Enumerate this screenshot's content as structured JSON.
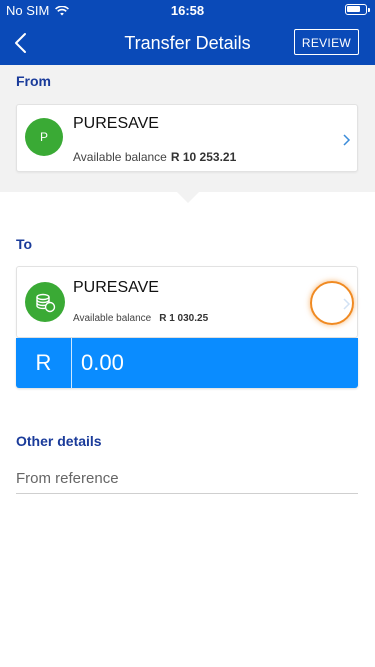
{
  "status_bar": {
    "carrier": "No SIM",
    "time": "16:58"
  },
  "header": {
    "title": "Transfer Details",
    "review_label": "REVIEW"
  },
  "from": {
    "label": "From",
    "account": {
      "avatar_letter": "P",
      "name": "PURESAVE",
      "balance_label": "Available balance",
      "balance_value": "R 10 253.21"
    }
  },
  "to": {
    "label": "To",
    "account": {
      "name": "PURESAVE",
      "balance_label": "Available balance",
      "balance_value": "R 1 030.25"
    }
  },
  "amount": {
    "currency": "R",
    "value": "0.00"
  },
  "other_details": {
    "label": "Other details",
    "reference_placeholder": "From reference"
  },
  "colors": {
    "header_blue": "#0a4ab8",
    "amount_blue": "#0a8cff",
    "label_blue": "#1a3b9a",
    "avatar_green": "#3aaa35",
    "highlight_orange": "#f08a22"
  },
  "icons": [
    "wifi-icon",
    "battery-icon",
    "back-chevron-icon",
    "chevron-right-icon",
    "coins-icon"
  ]
}
